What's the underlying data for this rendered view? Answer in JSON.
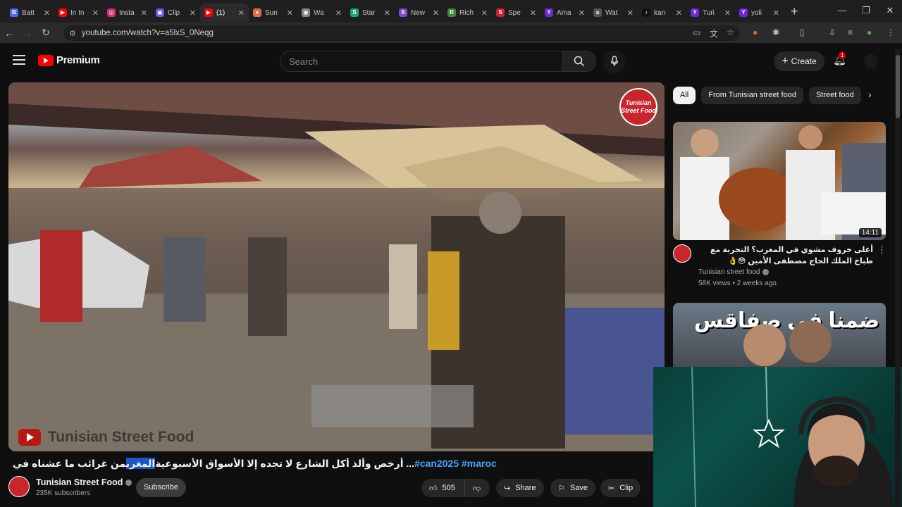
{
  "browser": {
    "tabs": [
      {
        "label": "Batt",
        "favicon_color": "#4a6cf7",
        "favicon_char": "B",
        "active": false
      },
      {
        "label": "In In",
        "favicon_color": "#ff0000",
        "favicon_char": "▶",
        "active": false
      },
      {
        "label": "Insta",
        "favicon_color": "#d62976",
        "favicon_char": "◎",
        "active": false
      },
      {
        "label": "Clip",
        "favicon_color": "#7a4cf0",
        "favicon_char": "▣",
        "active": false
      },
      {
        "label": "(1)",
        "favicon_color": "#ff0000",
        "favicon_char": "▶",
        "active": true
      },
      {
        "label": "Sun",
        "favicon_color": "#e06b4a",
        "favicon_char": "●",
        "active": false
      },
      {
        "label": "Wa",
        "favicon_color": "#888888",
        "favicon_char": "◉",
        "active": false
      },
      {
        "label": "Star",
        "favicon_color": "#1fa37a",
        "favicon_char": "S",
        "active": false
      },
      {
        "label": "New",
        "favicon_color": "#7b4cc9",
        "favicon_char": "S",
        "active": false
      },
      {
        "label": "Rich",
        "favicon_color": "#3a8d3a",
        "favicon_char": "R",
        "active": false
      },
      {
        "label": "Spe",
        "favicon_color": "#d11f2e",
        "favicon_char": "S",
        "active": false
      },
      {
        "label": "Ama",
        "favicon_color": "#6b2bd9",
        "favicon_char": "Y",
        "active": false
      },
      {
        "label": "Wat",
        "favicon_color": "#555555",
        "favicon_char": "a",
        "active": false
      },
      {
        "label": "karı",
        "favicon_color": "#111111",
        "favicon_char": "♪",
        "active": false
      },
      {
        "label": "Turi",
        "favicon_color": "#6b2bd9",
        "favicon_char": "Y",
        "active": false
      },
      {
        "label": "yoli",
        "favicon_color": "#6b2bd9",
        "favicon_char": "Y",
        "active": false
      }
    ],
    "new_tab_label": "+",
    "url": "youtube.com/watch?v=a5lxS_0Neqg",
    "window_controls": [
      "—",
      "❐",
      "✕"
    ]
  },
  "header": {
    "logo_text": "Premium",
    "search_placeholder": "Search",
    "create_label": "Create",
    "notification_count": "1"
  },
  "video": {
    "channel_logo_text": "Tunisian Street Food",
    "watermark_text": "Tunisian Street Food",
    "title_prefix": "من غرائب ما عشناه في ",
    "title_highlight": "المغرب",
    "title_suffix": " ... أرخص وألذ أكل الشارع لا تجده إلا الأسواق الأسبوعية",
    "title_tags": "#can2025 #maroc",
    "channel_name": "Tunisian Street Food",
    "subscribers": "235K subscribers",
    "subscribe_label": "Subscribe",
    "like_count": "505",
    "share_label": "Share",
    "save_label": "Save",
    "clip_label": "Clip"
  },
  "sidebar": {
    "chips": [
      "All",
      "From Tunisian street food",
      "Street food"
    ],
    "recommendations": [
      {
        "title": "أغلى خروف مشوي في المغرب؟ التجربة مع طباخ الملك الحاج مصطفى الأمين 😳👌",
        "channel": "Tunisian street food",
        "stats": "58K views • 2 weeks ago",
        "duration": "14:11"
      },
      {
        "title": "",
        "thumb_text": "ضمنا في صفاقس",
        "channel": "",
        "stats": "",
        "duration": ""
      }
    ]
  },
  "colors": {
    "youtube_red": "#ff0000",
    "link_blue": "#3ea6ff",
    "highlight_blue": "#1a56c7",
    "background": "#0f0f0f"
  }
}
